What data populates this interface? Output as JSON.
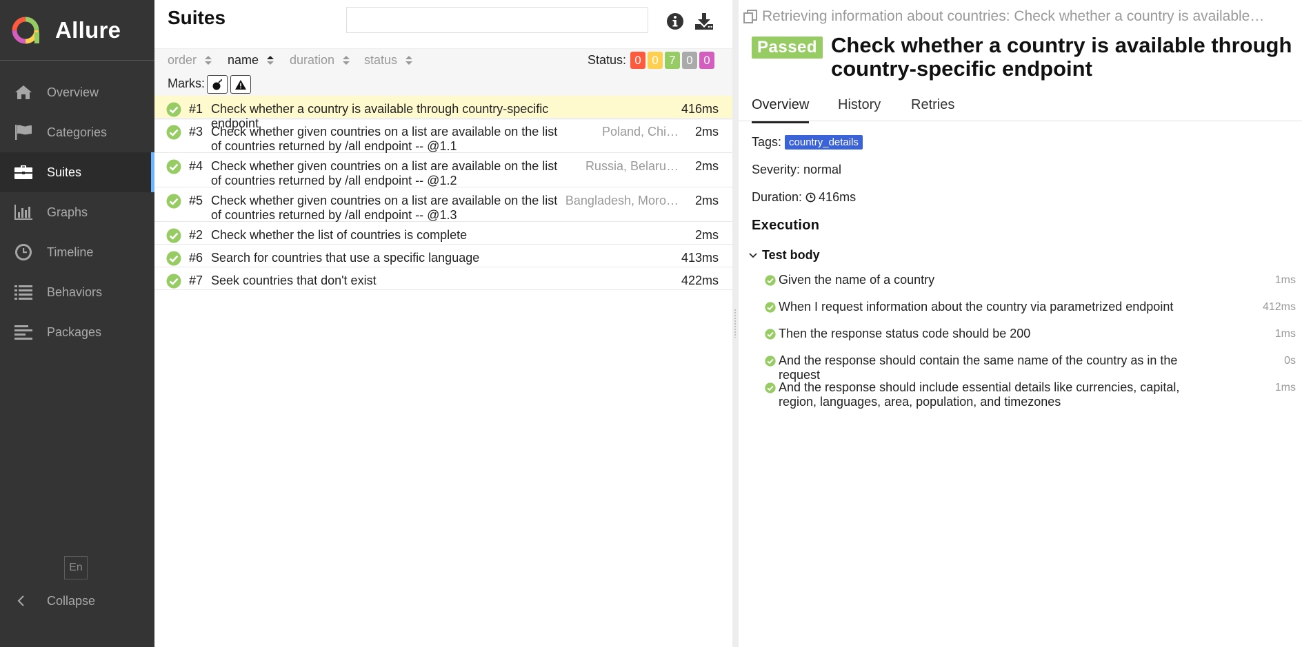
{
  "sidebar": {
    "brand": "Allure",
    "items": [
      {
        "label": "Overview",
        "icon": "home-icon"
      },
      {
        "label": "Categories",
        "icon": "flag-icon"
      },
      {
        "label": "Suites",
        "icon": "briefcase-icon"
      },
      {
        "label": "Graphs",
        "icon": "bar-chart-icon"
      },
      {
        "label": "Timeline",
        "icon": "clock-icon"
      },
      {
        "label": "Behaviors",
        "icon": "list-icon"
      },
      {
        "label": "Packages",
        "icon": "align-left-icon"
      }
    ],
    "active_item": "Suites",
    "language": "En",
    "collapse": "Collapse"
  },
  "suites": {
    "title": "Suites",
    "search": {
      "value": "",
      "placeholder": ""
    },
    "sort": {
      "order": "order",
      "name": "name",
      "duration": "duration",
      "status": "status"
    },
    "status_label": "Status:",
    "status_counts": [
      {
        "value": "0",
        "color": "#fd5a3e"
      },
      {
        "value": "0",
        "color": "#ffd050"
      },
      {
        "value": "7",
        "color": "#97cc64"
      },
      {
        "value": "0",
        "color": "#aaaaaa"
      },
      {
        "value": "0",
        "color": "#d35ebe"
      }
    ],
    "marks_label": "Marks:",
    "rows": [
      {
        "num": "#1",
        "name": "Check whether a country is available through country-specific endpoint",
        "params": "",
        "duration": "416ms"
      },
      {
        "num": "#3",
        "name": "Check whether given countries on a list are available on the list of countries returned by /all endpoint -- @1.1",
        "params": "Poland, Chi…",
        "duration": "2ms"
      },
      {
        "num": "#4",
        "name": "Check whether given countries on a list are available on the list of countries returned by /all endpoint -- @1.2",
        "params": "Russia, Belaru…",
        "duration": "2ms"
      },
      {
        "num": "#5",
        "name": "Check whether given countries on a list are available on the list of countries returned by /all endpoint -- @1.3",
        "params": "Bangladesh, Moro…",
        "duration": "2ms"
      },
      {
        "num": "#2",
        "name": "Check whether the list of countries is complete",
        "params": "",
        "duration": "2ms"
      },
      {
        "num": "#6",
        "name": "Search for countries that use a specific language",
        "params": "",
        "duration": "413ms"
      },
      {
        "num": "#7",
        "name": "Seek countries that don't exist",
        "params": "",
        "duration": "422ms"
      }
    ]
  },
  "detail": {
    "breadcrumb": "Retrieving information about countries: Check whether a country is available…",
    "status": "Passed",
    "title": "Check whether a country is available through country-specific endpoint",
    "tabs": [
      "Overview",
      "History",
      "Retries"
    ],
    "tags_label": "Tags:",
    "tag": "country_details",
    "severity": "Severity: normal",
    "duration_label": "Duration:",
    "duration": "416ms",
    "execution_title": "Execution",
    "test_body": "Test body",
    "steps": [
      {
        "text": "Given the name of a country",
        "duration": "1ms"
      },
      {
        "text": "When I request information about the country via parametrized endpoint",
        "duration": "412ms"
      },
      {
        "text": "Then the response status code should be 200",
        "duration": "1ms"
      },
      {
        "text": "And the response should contain the same name of the country as in the request",
        "duration": "0s"
      },
      {
        "text": "And the response should include essential details like currencies, capital, region, languages, area, population, and timezones",
        "duration": "1ms"
      }
    ]
  },
  "colors": {
    "passed": "#97cc64",
    "tag": "#3b63d9",
    "selected_row": "#fffacd",
    "sidebar": "#343434",
    "active_marker": "#6eb5ff"
  }
}
